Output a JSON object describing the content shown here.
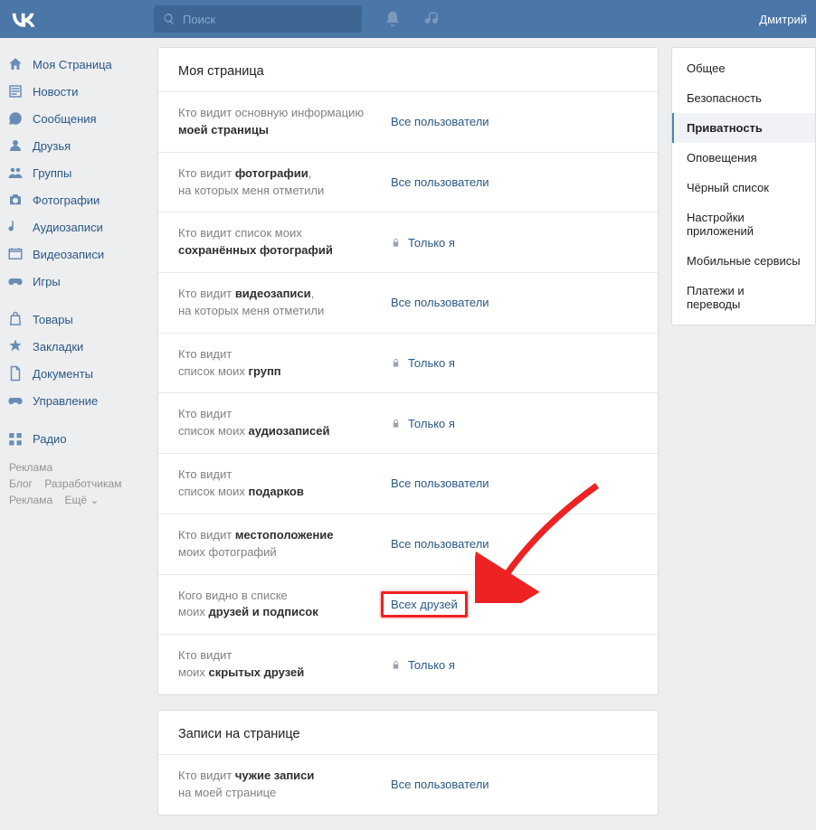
{
  "header": {
    "search_placeholder": "Поиск",
    "user_name": "Дмитрий"
  },
  "sidebar": {
    "items": [
      {
        "label": "Моя Страница",
        "icon": "home"
      },
      {
        "label": "Новости",
        "icon": "news"
      },
      {
        "label": "Сообщения",
        "icon": "messages"
      },
      {
        "label": "Друзья",
        "icon": "friends"
      },
      {
        "label": "Группы",
        "icon": "groups"
      },
      {
        "label": "Фотографии",
        "icon": "photos"
      },
      {
        "label": "Аудиозаписи",
        "icon": "audio"
      },
      {
        "label": "Видеозаписи",
        "icon": "video"
      },
      {
        "label": "Игры",
        "icon": "games"
      }
    ],
    "items2": [
      {
        "label": "Товары",
        "icon": "market"
      },
      {
        "label": "Закладки",
        "icon": "bookmarks"
      },
      {
        "label": "Документы",
        "icon": "docs"
      },
      {
        "label": "Управление",
        "icon": "manage"
      }
    ],
    "items3": [
      {
        "label": "Радио",
        "icon": "radio"
      }
    ],
    "footer": {
      "ad1": "Реклама",
      "blog": "Блог",
      "dev": "Разработчикам",
      "ad2": "Реклама",
      "more": "Ещё ⌄"
    }
  },
  "settings_menu": [
    "Общее",
    "Безопасность",
    "Приватность",
    "Оповещения",
    "Чёрный список",
    "Настройки приложений",
    "Мобильные сервисы",
    "Платежи и переводы"
  ],
  "settings_active": 2,
  "section1": {
    "title": "Моя страница",
    "rows": [
      {
        "pre": "Кто видит основную информацию ",
        "bold": "моей страницы",
        "post": "",
        "value": "Все пользователи",
        "lock": false
      },
      {
        "pre": "Кто видит ",
        "bold": "фотографии",
        "post": ",<br>на которых меня отметили",
        "value": "Все пользователи",
        "lock": false
      },
      {
        "pre": "Кто видит список моих<br>",
        "bold": "сохранённых фотографий",
        "post": "",
        "value": "Только я",
        "lock": true
      },
      {
        "pre": "Кто видит ",
        "bold": "видеозаписи",
        "post": ",<br>на которых меня отметили",
        "value": "Все пользователи",
        "lock": false
      },
      {
        "pre": "Кто видит<br>список моих ",
        "bold": "групп",
        "post": "",
        "value": "Только я",
        "lock": true
      },
      {
        "pre": "Кто видит<br>список моих ",
        "bold": "аудиозаписей",
        "post": "",
        "value": "Только я",
        "lock": true
      },
      {
        "pre": "Кто видит<br>список моих ",
        "bold": "подарков",
        "post": "",
        "value": "Все пользователи",
        "lock": false
      },
      {
        "pre": "Кто видит ",
        "bold": "местоположение",
        "post": "<br>моих фотографий",
        "value": "Все пользователи",
        "lock": false
      },
      {
        "pre": "Кого видно в списке<br>моих ",
        "bold": "друзей и подписок",
        "post": "",
        "value": "Всех друзей",
        "lock": false,
        "highlight": true
      },
      {
        "pre": "Кто видит<br>моих ",
        "bold": "скрытых друзей",
        "post": "",
        "value": "Только я",
        "lock": true
      }
    ]
  },
  "section2": {
    "title": "Записи на странице",
    "rows": [
      {
        "pre": "Кто видит ",
        "bold": "чужие записи",
        "post": "<br>на моей странице",
        "value": "Все пользователи",
        "lock": false
      }
    ]
  }
}
